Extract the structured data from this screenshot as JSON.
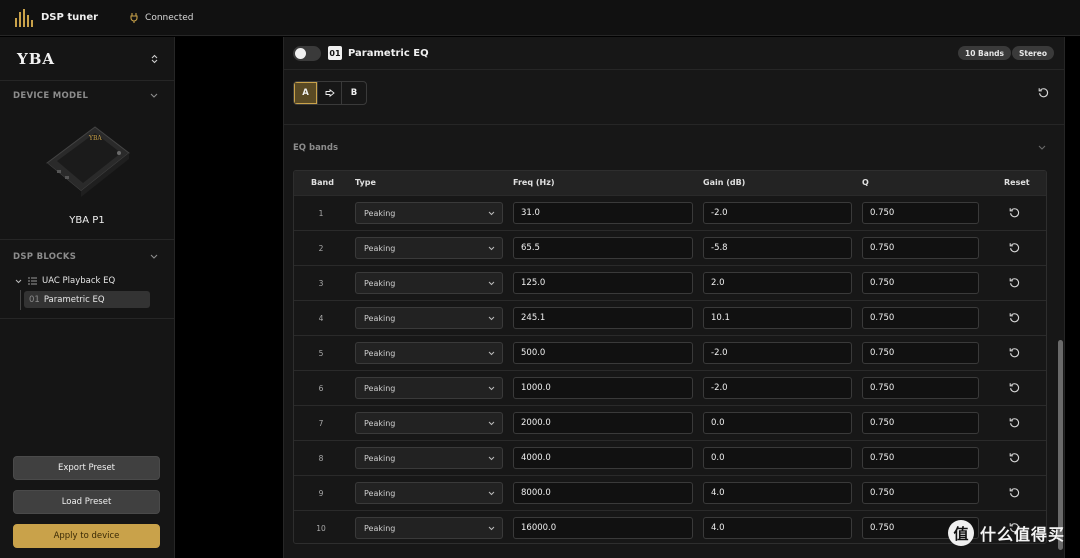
{
  "topbar": {
    "app_name": "DSP tuner",
    "status": "Connected"
  },
  "sidebar": {
    "brand": "YBA",
    "device_section": "DEVICE MODEL",
    "device_logo": "YBA",
    "device_name": "YBA P1",
    "blocks_section": "DSP BLOCKS",
    "tree_parent": "UAC Playback EQ",
    "tree_child_index": "01",
    "tree_child_label": "Parametric EQ",
    "export_label": "Export Preset",
    "load_label": "Load Preset",
    "apply_label": "Apply to device"
  },
  "panel": {
    "block_index": "01",
    "title": "Parametric EQ",
    "bands_pill": "10 Bands",
    "channel_pill": "Stereo",
    "ab_a": "A",
    "ab_b": "B",
    "eq_section": "EQ bands"
  },
  "table": {
    "headers": {
      "band": "Band",
      "type": "Type",
      "freq": "Freq (Hz)",
      "gain": "Gain (dB)",
      "q": "Q",
      "reset": "Reset"
    },
    "rows": [
      {
        "band": "1",
        "type": "Peaking",
        "freq": "31.0",
        "gain": "-2.0",
        "q": "0.750"
      },
      {
        "band": "2",
        "type": "Peaking",
        "freq": "65.5",
        "gain": "-5.8",
        "q": "0.750"
      },
      {
        "band": "3",
        "type": "Peaking",
        "freq": "125.0",
        "gain": "2.0",
        "q": "0.750"
      },
      {
        "band": "4",
        "type": "Peaking",
        "freq": "245.1",
        "gain": "10.1",
        "q": "0.750"
      },
      {
        "band": "5",
        "type": "Peaking",
        "freq": "500.0",
        "gain": "-2.0",
        "q": "0.750"
      },
      {
        "band": "6",
        "type": "Peaking",
        "freq": "1000.0",
        "gain": "-2.0",
        "q": "0.750"
      },
      {
        "band": "7",
        "type": "Peaking",
        "freq": "2000.0",
        "gain": "0.0",
        "q": "0.750"
      },
      {
        "band": "8",
        "type": "Peaking",
        "freq": "4000.0",
        "gain": "0.0",
        "q": "0.750"
      },
      {
        "band": "9",
        "type": "Peaking",
        "freq": "8000.0",
        "gain": "4.0",
        "q": "0.750"
      },
      {
        "band": "10",
        "type": "Peaking",
        "freq": "16000.0",
        "gain": "4.0",
        "q": "0.750"
      }
    ]
  },
  "watermark": {
    "symbol": "值",
    "text": "什么值得买"
  },
  "colors": {
    "accent": "#c9a24a",
    "background": "#000000",
    "panel": "#171717",
    "sidebar": "#151515"
  },
  "icons": [
    "logo-bars-icon",
    "plug-icon",
    "updown-chevron-icon",
    "chevron-down-icon",
    "list-icon",
    "arrow-right-icon",
    "reset-icon"
  ]
}
